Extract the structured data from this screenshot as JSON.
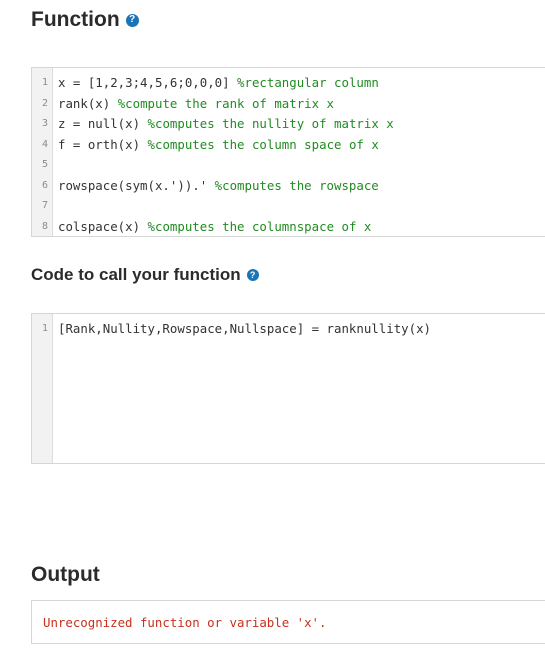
{
  "function_section": {
    "title": "Function",
    "help_icon": "question-circle-icon",
    "lines": [
      {
        "num": "1",
        "code": "x = [1,2,3;4,5,6;0,0,0] ",
        "comment": "%rectangular column"
      },
      {
        "num": "2",
        "code": "rank(x) ",
        "comment": "%compute the rank of matrix x"
      },
      {
        "num": "3",
        "code": "z = null(x) ",
        "comment": "%computes the nullity of matrix x"
      },
      {
        "num": "4",
        "code": "f = orth(x) ",
        "comment": "%computes the column space of x"
      },
      {
        "num": "5",
        "code": "",
        "comment": ""
      },
      {
        "num": "6",
        "code": "rowspace(sym(x.')).' ",
        "comment": "%computes the rowspace"
      },
      {
        "num": "7",
        "code": "",
        "comment": ""
      },
      {
        "num": "8",
        "code": "colspace(x) ",
        "comment": "%computes the columnspace of x"
      }
    ]
  },
  "call_section": {
    "title": "Code to call your function",
    "help_icon": "question-circle-icon",
    "lines": [
      {
        "num": "1",
        "code": "[Rank,Nullity,Rowspace,Nullspace] = ranknullity(x)",
        "comment": ""
      }
    ]
  },
  "output_section": {
    "title": "Output",
    "message": "Unrecognized function or variable 'x'."
  },
  "colors": {
    "comment": "#228b22",
    "error": "#c8301e",
    "help_icon": "#1a73b5"
  }
}
